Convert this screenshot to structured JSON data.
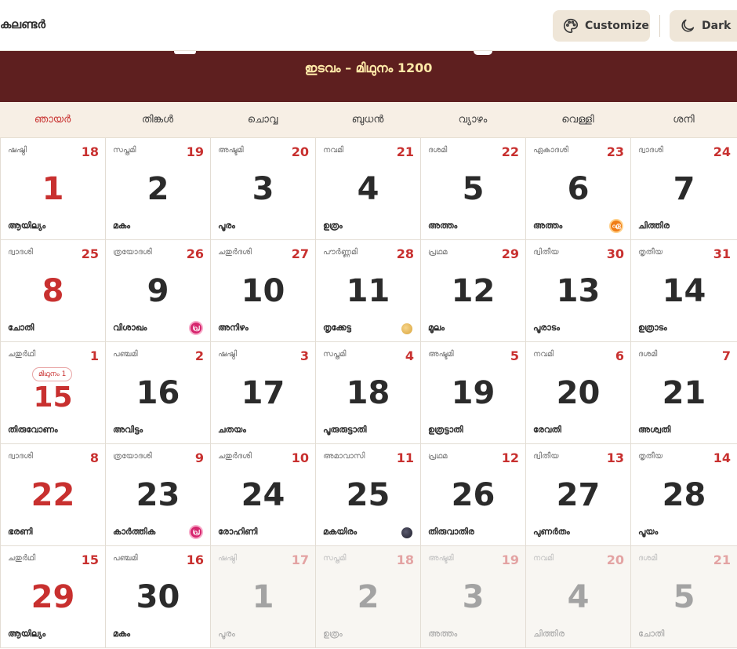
{
  "header": {
    "app_title": "കലണ്ടർ",
    "customize_label": "Customize",
    "dark_label": "Dark"
  },
  "banner": {
    "month_range": "ഇടവം – മിഥുനം 1200"
  },
  "colors": {
    "banner_bg": "#5e1f1f",
    "banner_text": "#ffe9a8",
    "accent_red": "#c8302f",
    "header_button_bg": "#efe6d8"
  },
  "weekdays": [
    "ഞായർ",
    "തിങ്കൾ",
    "ചൊവ്വ",
    "ബുധൻ",
    "വ്യാഴം",
    "വെള്ളി",
    "ശനി"
  ],
  "days": [
    {
      "tithi": "ഷഷ്ഠി",
      "malayalam_date": "18",
      "date": "1",
      "star": "ആയില്യം"
    },
    {
      "tithi": "സപ്തമി",
      "malayalam_date": "19",
      "date": "2",
      "star": "മകം"
    },
    {
      "tithi": "അഷ്ടമി",
      "malayalam_date": "20",
      "date": "3",
      "star": "പൂരം"
    },
    {
      "tithi": "നവമി",
      "malayalam_date": "21",
      "date": "4",
      "star": "ഉത്രം"
    },
    {
      "tithi": "ദശമി",
      "malayalam_date": "22",
      "date": "5",
      "star": "അത്തം"
    },
    {
      "tithi": "ഏകാദശി",
      "malayalam_date": "23",
      "date": "6",
      "star": "അത്തം",
      "badge": {
        "text": "ഏ",
        "kind": "orange",
        "icon": "ekadashi-icon"
      }
    },
    {
      "tithi": "ദ്വാദശി",
      "malayalam_date": "24",
      "date": "7",
      "star": "ചിത്തിര"
    },
    {
      "tithi": "ദ്വാദശി",
      "malayalam_date": "25",
      "date": "8",
      "star": "ചോതി"
    },
    {
      "tithi": "ത്രയോദശി",
      "malayalam_date": "26",
      "date": "9",
      "star": "വിശാഖം",
      "badge": {
        "text": "പ്ര",
        "kind": "pink",
        "icon": "pradosham-icon"
      }
    },
    {
      "tithi": "ചതുർദശി",
      "malayalam_date": "27",
      "date": "10",
      "star": "അനിഴം"
    },
    {
      "tithi": "പൗർണ്ണമി",
      "malayalam_date": "28",
      "date": "11",
      "star": "തൃക്കേട്ട",
      "moon": "full"
    },
    {
      "tithi": "പ്രഥമ",
      "malayalam_date": "29",
      "date": "12",
      "star": "മൂലം"
    },
    {
      "tithi": "ദ്വിതീയ",
      "malayalam_date": "30",
      "date": "13",
      "star": "പൂരാടം"
    },
    {
      "tithi": "തൃതീയ",
      "malayalam_date": "31",
      "date": "14",
      "star": "ഉത്രാടം"
    },
    {
      "tithi": "ചതുർഥി",
      "malayalam_date": "1",
      "date": "15",
      "star": "തിരുവോണം",
      "month_badge": "മിഥുനം 1"
    },
    {
      "tithi": "പഞ്ചമി",
      "malayalam_date": "2",
      "date": "16",
      "star": "അവിട്ടം"
    },
    {
      "tithi": "ഷഷ്ഠി",
      "malayalam_date": "3",
      "date": "17",
      "star": "ചതയം"
    },
    {
      "tithi": "സപ്തമി",
      "malayalam_date": "4",
      "date": "18",
      "star": "പൂരുരുട്ടാതി"
    },
    {
      "tithi": "അഷ്ടമി",
      "malayalam_date": "5",
      "date": "19",
      "star": "ഉത്രട്ടാതി"
    },
    {
      "tithi": "നവമി",
      "malayalam_date": "6",
      "date": "20",
      "star": "രേവതി"
    },
    {
      "tithi": "ദശമി",
      "malayalam_date": "7",
      "date": "21",
      "star": "അശ്വതി"
    },
    {
      "tithi": "ദ്വാദശി",
      "malayalam_date": "8",
      "date": "22",
      "star": "ഭരണി"
    },
    {
      "tithi": "ത്രയോദശി",
      "malayalam_date": "9",
      "date": "23",
      "star": "കാർത്തിക",
      "badge": {
        "text": "പ്ര",
        "kind": "pink",
        "icon": "pradosham-icon"
      }
    },
    {
      "tithi": "ചതുർദശി",
      "malayalam_date": "10",
      "date": "24",
      "star": "രോഹിണി"
    },
    {
      "tithi": "അമാവാസി",
      "malayalam_date": "11",
      "date": "25",
      "star": "മകയിരം",
      "moon": "new"
    },
    {
      "tithi": "പ്രഥമ",
      "malayalam_date": "12",
      "date": "26",
      "star": "തിരുവാതിര"
    },
    {
      "tithi": "ദ്വിതീയ",
      "malayalam_date": "13",
      "date": "27",
      "star": "പുണർതം"
    },
    {
      "tithi": "തൃതീയ",
      "malayalam_date": "14",
      "date": "28",
      "star": "പൂയം"
    },
    {
      "tithi": "ചതുർഥി",
      "malayalam_date": "15",
      "date": "29",
      "star": "ആയില്യം"
    },
    {
      "tithi": "പഞ്ചമി",
      "malayalam_date": "16",
      "date": "30",
      "star": "മകം"
    },
    {
      "tithi": "ഷഷ്ഠി",
      "malayalam_date": "17",
      "date": "1",
      "star": "പൂരം",
      "other_month": true
    },
    {
      "tithi": "സപ്തമി",
      "malayalam_date": "18",
      "date": "2",
      "star": "ഉത്രം",
      "other_month": true
    },
    {
      "tithi": "അഷ്ടമി",
      "malayalam_date": "19",
      "date": "3",
      "star": "അത്തം",
      "other_month": true
    },
    {
      "tithi": "നവമി",
      "malayalam_date": "20",
      "date": "4",
      "star": "ചിത്തിര",
      "other_month": true
    },
    {
      "tithi": "ദശമി",
      "malayalam_date": "21",
      "date": "5",
      "star": "ചോതി",
      "other_month": true
    }
  ]
}
